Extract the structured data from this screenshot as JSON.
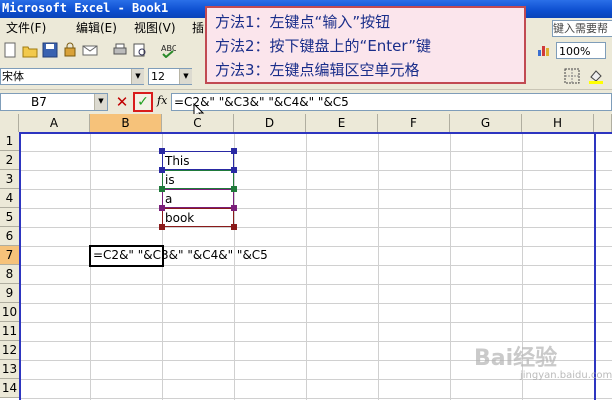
{
  "window": {
    "title": "Microsoft Excel - Book1"
  },
  "menu": {
    "items": [
      "文件(F)",
      "编辑(E)",
      "视图(V)",
      "插"
    ],
    "help_placeholder": "键入需要帮"
  },
  "toolbar": {
    "zoom": "100%"
  },
  "format_toolbar": {
    "font": "宋体",
    "size": "12"
  },
  "formula_bar": {
    "name_box": "B7",
    "formula": "=C2&\" \"&C3&\" \"&C4&\" \"&C5",
    "fx": "fx"
  },
  "columns": [
    "A",
    "B",
    "C",
    "D",
    "E",
    "F",
    "G",
    "H"
  ],
  "rows": [
    "1",
    "2",
    "3",
    "4",
    "5",
    "6",
    "7",
    "8",
    "9",
    "10",
    "11",
    "12",
    "13",
    "14"
  ],
  "cells": {
    "C2": "This",
    "C3": "is",
    "C4": "a",
    "C5": "book",
    "B7": "=C2&\" \"&C3&\" \"&C4&\" \"&C5"
  },
  "callout": {
    "lines": [
      "方法1：左键点“输入”按钮",
      "方法2：按下键盘上的“Enter”键",
      "方法3：左键点编辑区空单元格"
    ]
  },
  "watermark": {
    "brand": "Bai经验",
    "sub": "jingyan.baidu.com"
  },
  "colors": {
    "range_c2": "#2929a3",
    "range_c3": "#1f7a3a",
    "range_c4": "#7a1f7a",
    "range_c5": "#8a1a1a",
    "accent_red": "#d91c1c",
    "active_header": "#f6c27a"
  }
}
